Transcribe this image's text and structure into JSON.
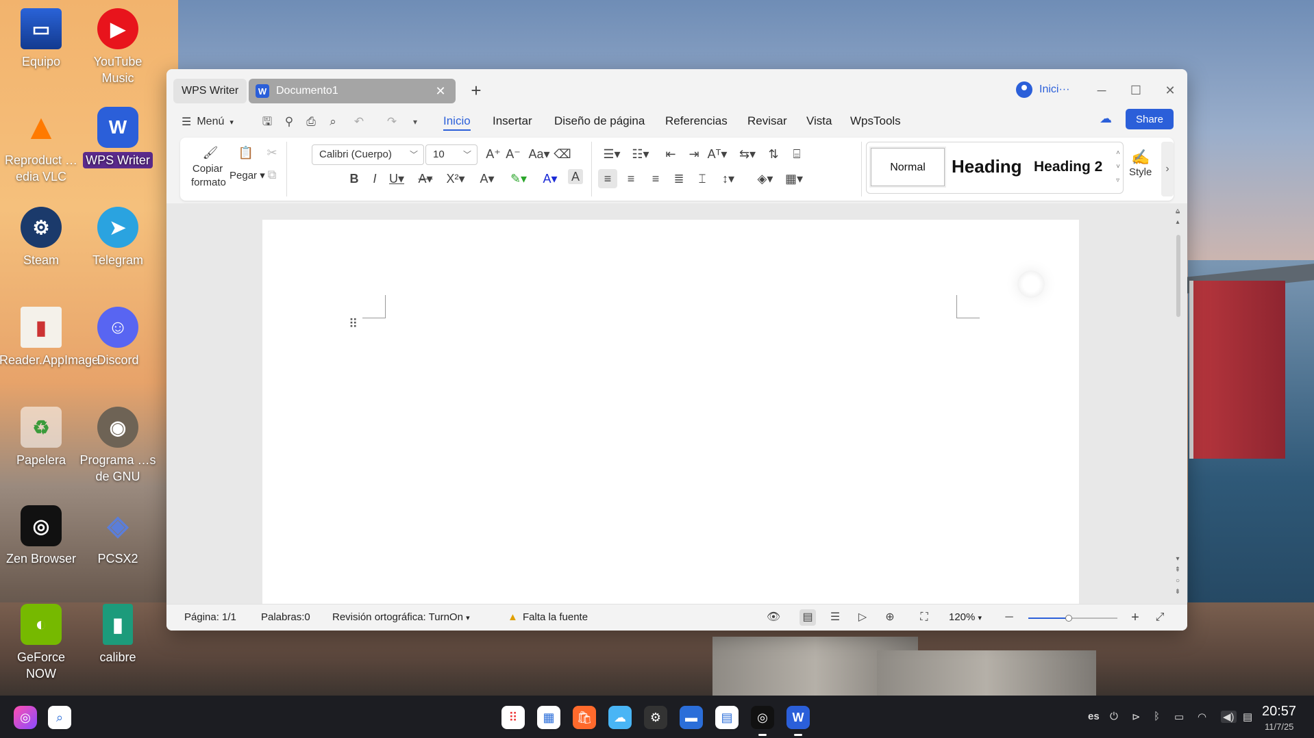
{
  "desktop": {
    "icons": [
      {
        "label": "Equipo"
      },
      {
        "label": "YouTube Music"
      },
      {
        "label": "Reproduct …edia VLC"
      },
      {
        "label": "WPS Writer"
      },
      {
        "label": "Steam"
      },
      {
        "label": "Telegram"
      },
      {
        "label": "FBReader.AppImage"
      },
      {
        "label": "Discord"
      },
      {
        "label": "Papelera"
      },
      {
        "label": "Programa …s de GNU"
      },
      {
        "label": "Zen Browser"
      },
      {
        "label": "PCSX2"
      },
      {
        "label": "GeForce NOW"
      },
      {
        "label": "calibre"
      }
    ]
  },
  "window": {
    "app_tab": "WPS Writer",
    "doc_tab": "Documento1",
    "doc_tab_close": "✕",
    "new_tab": "+",
    "account": "Inici···",
    "btn_min": "─",
    "btn_max": "☐",
    "btn_close": "✕"
  },
  "menubar": {
    "menu_label": "Menú",
    "tabs": [
      "Inicio",
      "Insertar",
      "Diseño de página",
      "Referencias",
      "Revisar",
      "Vista",
      "WpsTools"
    ],
    "share": "Share"
  },
  "ribbon": {
    "copy_format": "Copiar formato",
    "paste": "Pegar",
    "font_name": "Calibri (Cuerpo)",
    "font_size": "10",
    "styles": [
      "Normal",
      "Heading",
      "Heading 2"
    ],
    "style_button": "Style"
  },
  "statusbar": {
    "page": "Página: 1/1",
    "words": "Palabras:0",
    "spell": "Revisión ortográfica: TurnOn",
    "missing_font": "Falta la fuente",
    "zoom": "120%",
    "zoom_level": 0.45
  },
  "taskbar": {
    "lang": "es",
    "time": "20:57",
    "date": "11/7/25"
  }
}
